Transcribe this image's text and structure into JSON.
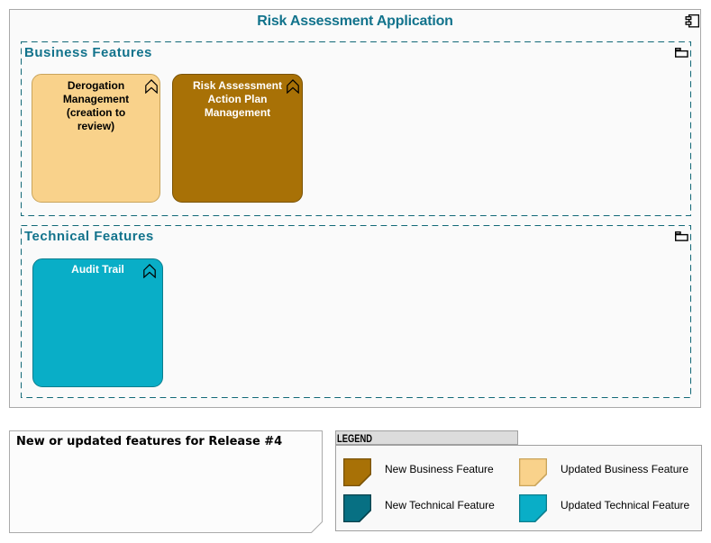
{
  "colors": {
    "page_bg": "#FFFFFF",
    "container_bg": "#FAFAFA",
    "container_border": "#A9A9A9",
    "teal_text": "#12738C",
    "group_border": "#116877",
    "new_business": "#A87106",
    "new_business_border": "#7A5305",
    "updated_business": "#F9D28B",
    "updated_business_border": "#C9A45B",
    "new_technical": "#077083",
    "new_technical_border": "#04414C",
    "updated_technical": "#09AEC7",
    "updated_technical_border": "#0B7E8E",
    "card_text_dark": "#000000",
    "card_text_light": "#FFFFFF"
  },
  "application": {
    "title": "Risk Assessment Application"
  },
  "groups": [
    {
      "label": "Business Features",
      "cards": [
        {
          "label": "Derogation\nManagement\n(creation to\nreview)",
          "status": "updated-business-feature"
        },
        {
          "label": "Risk Assessment\nAction Plan\nManagement",
          "status": "new-business-feature"
        }
      ]
    },
    {
      "label": "Technical Features",
      "cards": [
        {
          "label": "Audit Trail",
          "status": "updated-technical-feature"
        }
      ]
    }
  ],
  "note": {
    "text": "New or updated features for Release #4"
  },
  "legend": {
    "title": "LEGEND",
    "items": [
      {
        "label": "New Business Feature",
        "color": "#A87106",
        "border": "#7A5305"
      },
      {
        "label": "Updated Business Feature",
        "color": "#F9D28B",
        "border": "#C9A45B"
      },
      {
        "label": "New Technical Feature",
        "color": "#077083",
        "border": "#04414C"
      },
      {
        "label": "Updated Technical Feature",
        "color": "#09AEC7",
        "border": "#0B7E8E"
      }
    ]
  }
}
